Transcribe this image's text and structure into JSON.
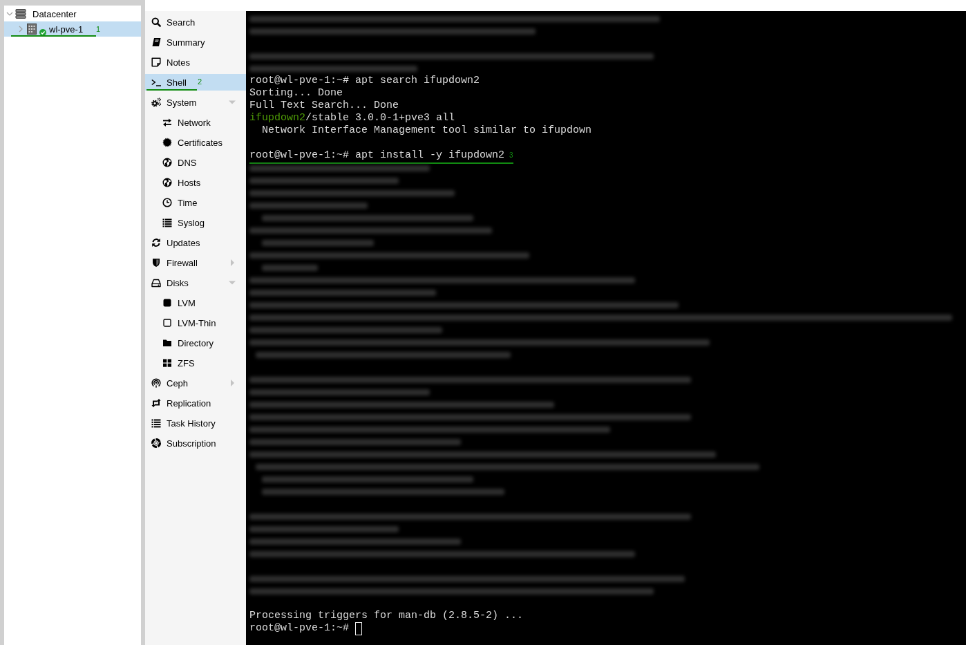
{
  "tree": {
    "nodes": [
      {
        "label": "Datacenter",
        "expanded": true,
        "selected": false,
        "children": [
          {
            "label": "wl-pve-1",
            "expanded": false,
            "selected": true,
            "online": true,
            "annotation": "1"
          }
        ]
      }
    ]
  },
  "menu": {
    "items": [
      {
        "kind": "item",
        "label": "Search",
        "selected": false
      },
      {
        "kind": "item",
        "label": "Summary",
        "selected": false
      },
      {
        "kind": "item",
        "label": "Notes",
        "selected": false
      },
      {
        "kind": "item",
        "label": "Shell",
        "selected": true,
        "annotation": "2"
      },
      {
        "kind": "group",
        "label": "System",
        "selected": false,
        "expanded": true,
        "children": [
          {
            "kind": "item",
            "label": "Network",
            "selected": false
          },
          {
            "kind": "item",
            "label": "Certificates",
            "selected": false
          },
          {
            "kind": "item",
            "label": "DNS",
            "selected": false
          },
          {
            "kind": "item",
            "label": "Hosts",
            "selected": false
          },
          {
            "kind": "item",
            "label": "Time",
            "selected": false
          },
          {
            "kind": "item",
            "label": "Syslog",
            "selected": false
          }
        ]
      },
      {
        "kind": "item",
        "label": "Updates",
        "selected": false
      },
      {
        "kind": "group",
        "label": "Firewall",
        "selected": false,
        "expanded": false
      },
      {
        "kind": "group",
        "label": "Disks",
        "selected": false,
        "expanded": true,
        "children": [
          {
            "kind": "item",
            "label": "LVM",
            "selected": false
          },
          {
            "kind": "item",
            "label": "LVM-Thin",
            "selected": false
          },
          {
            "kind": "item",
            "label": "Directory",
            "selected": false
          },
          {
            "kind": "item",
            "label": "ZFS",
            "selected": false
          }
        ]
      },
      {
        "kind": "group",
        "label": "Ceph",
        "selected": false,
        "expanded": false
      },
      {
        "kind": "item",
        "label": "Replication",
        "selected": false
      },
      {
        "kind": "item",
        "label": "Task History",
        "selected": false
      },
      {
        "kind": "item",
        "label": "Subscription",
        "selected": false
      }
    ]
  },
  "terminal": {
    "lines": [
      {
        "kind": "blurred"
      },
      {
        "kind": "blurred"
      },
      {
        "kind": "blank"
      },
      {
        "kind": "blurred"
      },
      {
        "kind": "blurred"
      },
      {
        "kind": "text",
        "text": "root@wl-pve-1:~# apt search ifupdown2"
      },
      {
        "kind": "text",
        "text": "Sorting... Done"
      },
      {
        "kind": "text",
        "text": "Full Text Search... Done"
      },
      {
        "kind": "package",
        "name": "ifupdown2",
        "text": "/stable 3.0.0-1+pve3 all"
      },
      {
        "kind": "description",
        "text": "Network Interface Management tool similar to ifupdown"
      },
      {
        "kind": "blank"
      },
      {
        "kind": "text",
        "text": "root@wl-pve-1:~# apt install -y ifupdown2",
        "annotation": "3"
      },
      {
        "kind": "blurred"
      },
      {
        "kind": "blurred"
      },
      {
        "kind": "blurred"
      },
      {
        "kind": "blurred"
      },
      {
        "kind": "blurred"
      },
      {
        "kind": "blurred"
      },
      {
        "kind": "blurred"
      },
      {
        "kind": "blurred"
      },
      {
        "kind": "blurred"
      },
      {
        "kind": "blurred"
      },
      {
        "kind": "blurred"
      },
      {
        "kind": "blurred"
      },
      {
        "kind": "blurred"
      },
      {
        "kind": "blurred"
      },
      {
        "kind": "blurred"
      },
      {
        "kind": "blurred"
      },
      {
        "kind": "blank"
      },
      {
        "kind": "blurred"
      },
      {
        "kind": "blurred"
      },
      {
        "kind": "blurred"
      },
      {
        "kind": "blurred"
      },
      {
        "kind": "blurred"
      },
      {
        "kind": "blurred"
      },
      {
        "kind": "blurred"
      },
      {
        "kind": "blurred"
      },
      {
        "kind": "blurred"
      },
      {
        "kind": "blurred"
      },
      {
        "kind": "blank"
      },
      {
        "kind": "blurred"
      },
      {
        "kind": "blurred"
      },
      {
        "kind": "blurred"
      },
      {
        "kind": "blurred"
      },
      {
        "kind": "blank"
      },
      {
        "kind": "blurred"
      },
      {
        "kind": "blurred"
      },
      {
        "kind": "blank"
      },
      {
        "kind": "text",
        "text": "Processing triggers for man-db (2.8.5-2) ..."
      },
      {
        "kind": "prompt",
        "text": "root@wl-pve-1:~#",
        "cursor": true
      }
    ]
  }
}
